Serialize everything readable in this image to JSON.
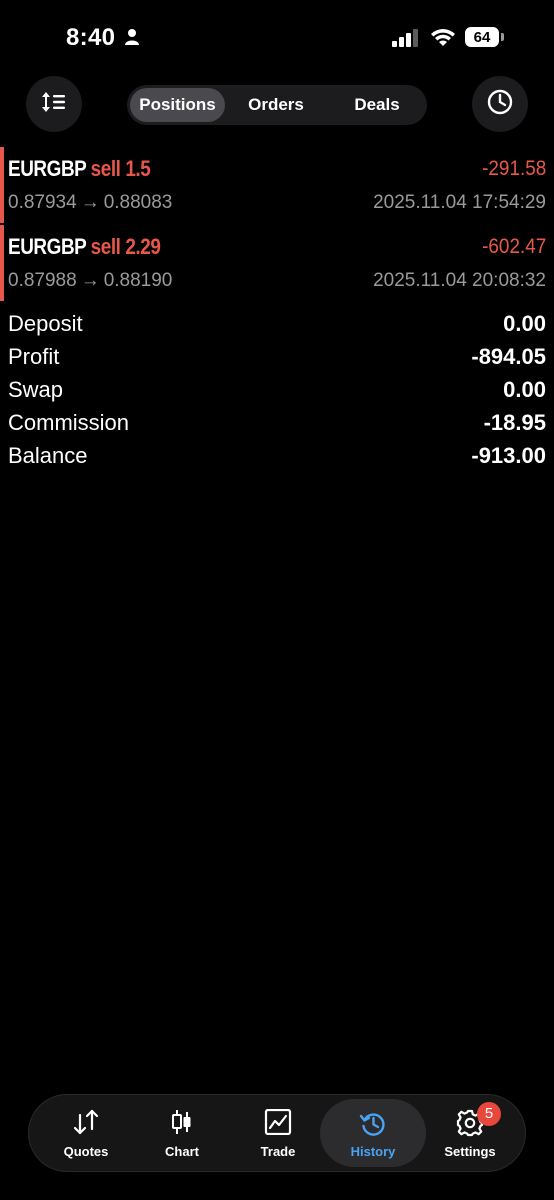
{
  "status_bar": {
    "time": "8:40",
    "battery": "64"
  },
  "tabs_top": {
    "positions": "Positions",
    "orders": "Orders",
    "deals": "Deals"
  },
  "positions": [
    {
      "symbol": "EURGBP",
      "type": "sell 1.5",
      "profit": "-291.58",
      "open_price": "0.87934",
      "arrow": "→",
      "close_price": "0.88083",
      "time": "2025.11.04 17:54:29"
    },
    {
      "symbol": "EURGBP",
      "type": "sell 2.29",
      "profit": "-602.47",
      "open_price": "0.87988",
      "arrow": "→",
      "close_price": "0.88190",
      "time": "2025.11.04 20:08:32"
    }
  ],
  "summary": [
    {
      "label": "Deposit",
      "value": "0.00"
    },
    {
      "label": "Profit",
      "value": "-894.05"
    },
    {
      "label": "Swap",
      "value": "0.00"
    },
    {
      "label": "Commission",
      "value": "-18.95"
    },
    {
      "label": "Balance",
      "value": "-913.00"
    }
  ],
  "tab_bar": {
    "quotes": "Quotes",
    "chart": "Chart",
    "trade": "Trade",
    "history": "History",
    "settings": "Settings",
    "settings_badge": "5"
  },
  "colors": {
    "loss": "#e8584a",
    "accent": "#4aa3f2",
    "badge": "#e8473c"
  }
}
